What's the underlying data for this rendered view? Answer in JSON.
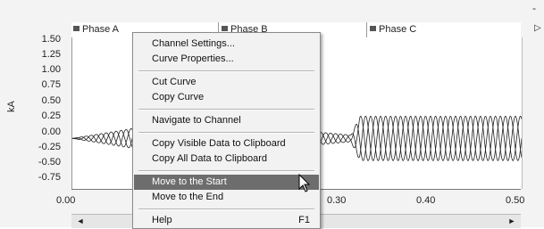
{
  "window": {
    "top_right_glyph": "-"
  },
  "tabs": [
    {
      "label": "Phase A"
    },
    {
      "label": "Phase B"
    },
    {
      "label": "Phase C"
    }
  ],
  "tab_scroll_arrow": "▷",
  "axis": {
    "ylabel": "kA",
    "yticks": [
      "1.50",
      "1.25",
      "1.00",
      "0.75",
      "0.50",
      "0.25",
      "0.00",
      "-0.25",
      "-0.50",
      "-0.75"
    ],
    "xticks": [
      "0.00",
      "0.30",
      "0.40",
      "0.50"
    ]
  },
  "scrollbar": {
    "left_arrow": "◄",
    "right_arrow": "►"
  },
  "context_menu": {
    "items": [
      {
        "label": "Channel Settings..."
      },
      {
        "label": "Curve Properties..."
      },
      {
        "label": "Cut Curve"
      },
      {
        "label": "Copy Curve"
      },
      {
        "label": "Navigate to Channel"
      },
      {
        "label": "Copy Visible Data to Clipboard"
      },
      {
        "label": "Copy All Data to Clipboard"
      },
      {
        "label": "Move to the Start"
      },
      {
        "label": "Move to the End"
      },
      {
        "label": "Help",
        "shortcut": "F1"
      }
    ]
  },
  "chart_data": {
    "type": "line",
    "ylabel": "kA",
    "xlim": [
      0.0,
      0.5
    ],
    "ylim": [
      -0.75,
      1.5
    ],
    "yticks": [
      1.5,
      1.25,
      1.0,
      0.75,
      0.5,
      0.25,
      0.0,
      -0.25,
      -0.5,
      -0.75
    ],
    "series": [
      {
        "name": "Phase A",
        "amplitude_envelope": [
          [
            0.0,
            0.0
          ],
          [
            0.09,
            0.2
          ],
          [
            0.27,
            0.1
          ],
          [
            0.31,
            0.05
          ],
          [
            0.32,
            0.33
          ],
          [
            0.5,
            0.33
          ]
        ],
        "frequency_cycles": 60
      },
      {
        "name": "Phase B",
        "amplitude_envelope": [
          [
            0.0,
            0.0
          ],
          [
            0.09,
            0.2
          ],
          [
            0.27,
            0.1
          ],
          [
            0.31,
            0.05
          ],
          [
            0.32,
            0.33
          ],
          [
            0.5,
            0.33
          ]
        ],
        "frequency_cycles": 60
      },
      {
        "name": "Phase C",
        "amplitude_envelope": [
          [
            0.0,
            0.0
          ],
          [
            0.09,
            0.2
          ],
          [
            0.27,
            0.1
          ],
          [
            0.31,
            0.05
          ],
          [
            0.32,
            0.33
          ],
          [
            0.5,
            0.33
          ]
        ],
        "frequency_cycles": 60
      }
    ],
    "line_color": "#222222"
  }
}
